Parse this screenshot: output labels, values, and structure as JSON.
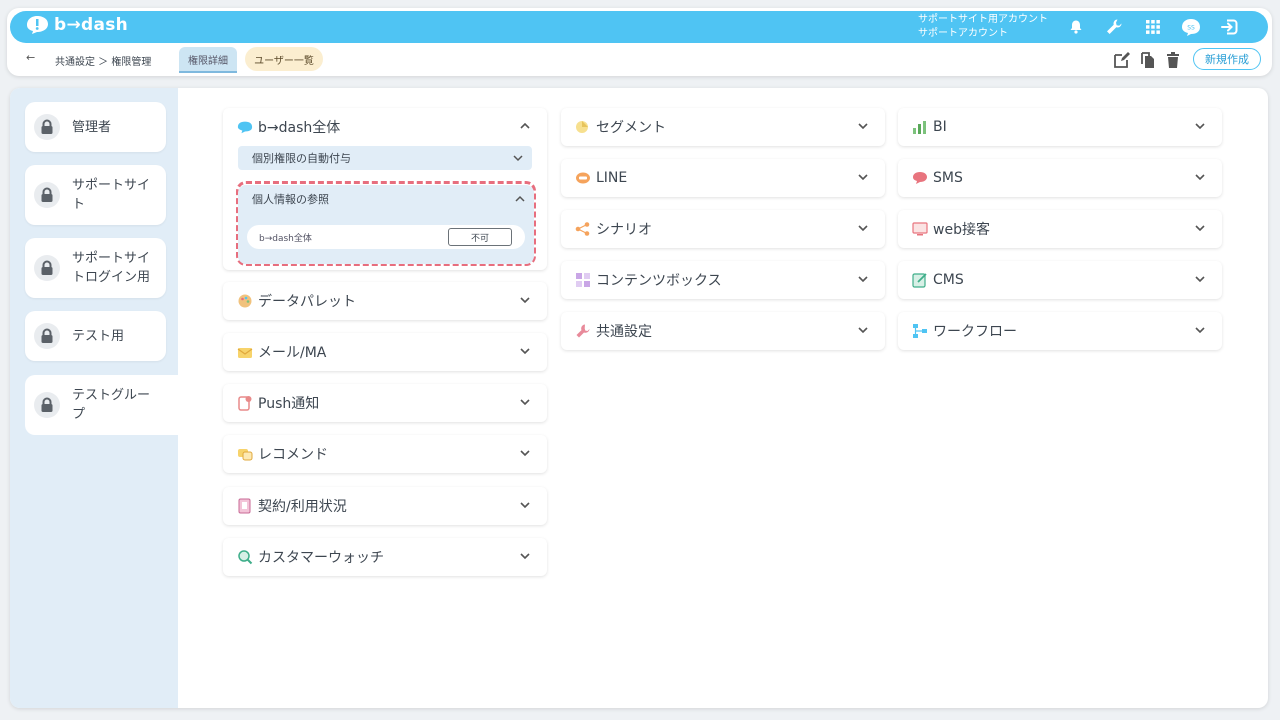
{
  "app": {
    "logo_text": "b→dash",
    "account_line1": "サポートサイト用アカウント",
    "account_line2": "サポートアカウント"
  },
  "header_icons": [
    "bell-icon",
    "wrench-icon",
    "grid-icon",
    "user-icon",
    "logout-icon"
  ],
  "breadcrumb": {
    "back": "←",
    "text": "共通設定 ＞ 権限管理"
  },
  "tabs": {
    "detail": "権限詳細",
    "users": "ユーザー一覧"
  },
  "actions": {
    "new_label": "新規作成"
  },
  "roles": [
    {
      "label": "管理者"
    },
    {
      "label": "サポートサイト"
    },
    {
      "label": "サポートサイトログイン用"
    },
    {
      "label": "テスト用"
    },
    {
      "label": "テストグループ"
    }
  ],
  "expanded_panel": {
    "title": "b→dash全体",
    "sub_auto": "個別権限の自動付与",
    "sub_personal": "個人情報の参照",
    "detail_label": "b→dash全体",
    "detail_value": "不可"
  },
  "panels_col1": [
    {
      "title": "データパレット",
      "icon": "palette-icon"
    },
    {
      "title": "メール/MA",
      "icon": "mail-icon"
    },
    {
      "title": "Push通知",
      "icon": "push-icon"
    },
    {
      "title": "レコメンド",
      "icon": "recommend-icon"
    },
    {
      "title": "契約/利用状況",
      "icon": "contract-icon"
    },
    {
      "title": "カスタマーウォッチ",
      "icon": "watch-icon"
    }
  ],
  "panels_col2": [
    {
      "title": "セグメント",
      "icon": "segment-icon"
    },
    {
      "title": "LINE",
      "icon": "line-icon"
    },
    {
      "title": "シナリオ",
      "icon": "scenario-icon"
    },
    {
      "title": "コンテンツボックス",
      "icon": "contentbox-icon"
    },
    {
      "title": "共通設定",
      "icon": "settings-icon"
    }
  ],
  "panels_col3": [
    {
      "title": "BI",
      "icon": "bi-icon"
    },
    {
      "title": "SMS",
      "icon": "sms-icon"
    },
    {
      "title": "web接客",
      "icon": "web-icon"
    },
    {
      "title": "CMS",
      "icon": "cms-icon"
    },
    {
      "title": "ワークフロー",
      "icon": "workflow-icon"
    }
  ],
  "colors": {
    "brand": "#4fc4f3",
    "highlight_dash": "#e76e7e",
    "sidebar_bg": "#e1edf7"
  }
}
